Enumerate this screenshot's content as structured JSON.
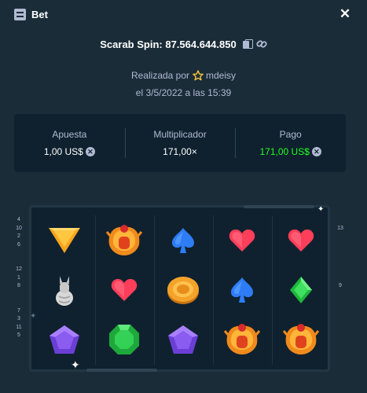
{
  "header": {
    "title": "Bet",
    "close_label": "✕"
  },
  "spin": {
    "label": "Scarab Spin: 87.564.644.850"
  },
  "placed": {
    "prefix": "Realizada por",
    "user": "mdeisy"
  },
  "date": {
    "text": "el 3/5/2022 a las 15:39"
  },
  "stats": {
    "bet_label": "Apuesta",
    "bet_value": "1,00 US$",
    "mult_label": "Multiplicador",
    "mult_value": "171,00×",
    "payout_label": "Pago",
    "payout_value": "171,00 US$"
  },
  "left_numbers": [
    "4",
    "10",
    "2",
    "6",
    "",
    "",
    "12",
    "1",
    "8",
    "",
    "",
    "7",
    "3",
    "11",
    "5"
  ],
  "right_numbers": [
    "",
    "13",
    "",
    "",
    "",
    "",
    "",
    "",
    "9",
    "",
    "",
    "",
    "",
    "",
    ""
  ],
  "reels": [
    [
      "triangle-gem",
      "vase",
      "pentagon-gem"
    ],
    [
      "scarab",
      "heart",
      "emerald-gem"
    ],
    [
      "spade",
      "coin",
      "pentagon-gem"
    ],
    [
      "heart",
      "spade",
      "scarab"
    ],
    [
      "heart",
      "diamond-gem",
      "scarab"
    ]
  ],
  "colors": {
    "background": "#1a2c38",
    "panel": "#0f212e",
    "accent_green": "#1fff20",
    "star": "#f6c33a"
  }
}
